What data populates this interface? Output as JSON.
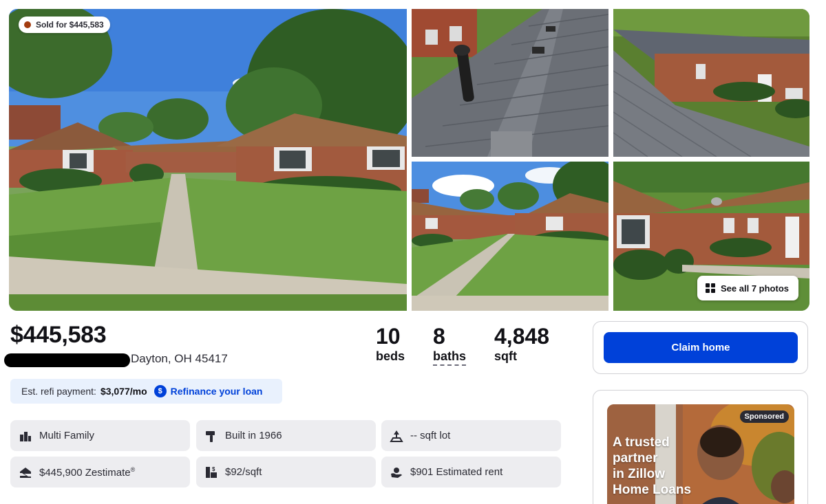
{
  "gallery": {
    "sold_badge": "Sold for $445,583",
    "see_all_label": "See all 7 photos"
  },
  "summary": {
    "price": "$445,583",
    "address_visible": "Dayton, OH 45417",
    "beds_value": "10",
    "beds_label": "beds",
    "baths_value": "8",
    "baths_label": "baths",
    "sqft_value": "4,848",
    "sqft_label": "sqft"
  },
  "refi": {
    "label": "Est. refi payment:",
    "amount": "$3,077/mo",
    "coin_symbol": "$",
    "link": "Refinance your loan"
  },
  "facts_chips": [
    {
      "icon": "multi-family-icon",
      "text": "Multi Family"
    },
    {
      "icon": "hammer-icon",
      "text": "Built in 1966"
    },
    {
      "icon": "lot-icon",
      "text": "-- sqft lot"
    },
    {
      "icon": "zestimate-icon",
      "text": "$445,900 Zestimate",
      "sup": "®"
    },
    {
      "icon": "price-per-sqft-icon",
      "text": "$92/sqft"
    },
    {
      "icon": "rent-icon",
      "text": "$901 Estimated rent"
    }
  ],
  "claim": {
    "button_label": "Claim home"
  },
  "ad": {
    "sponsored_label": "Sponsored",
    "headline_line1": "A trusted",
    "headline_line2": "partner",
    "headline_line3": "in Zillow",
    "headline_line4": "Home Loans"
  },
  "colors": {
    "brand_blue": "#0041d9",
    "sold_dot": "#a33c0f",
    "chip_bg": "#ededf0",
    "refi_bg": "#e9f1fd"
  }
}
